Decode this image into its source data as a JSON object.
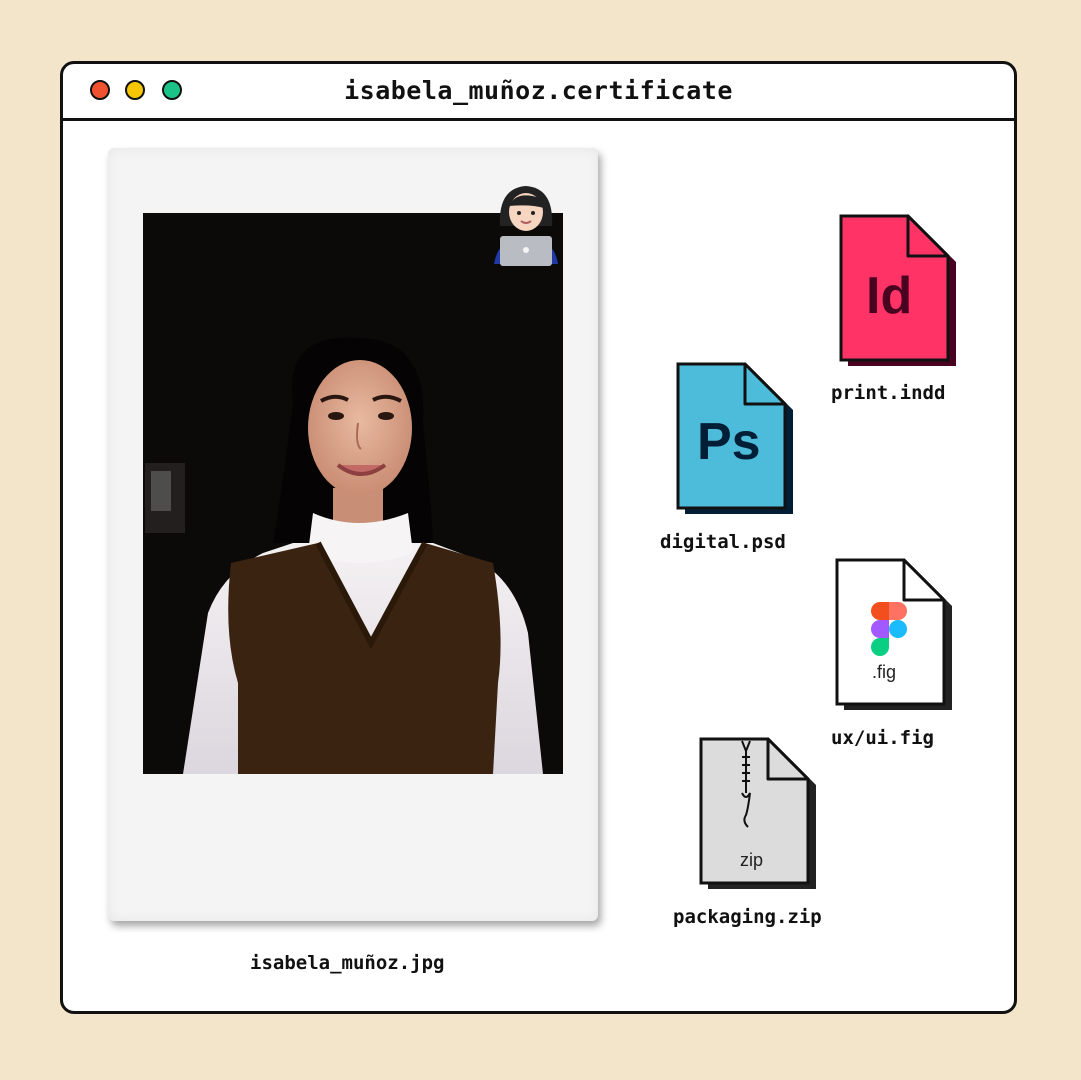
{
  "window": {
    "title": "isabela_muñoz.certificate",
    "controls": [
      {
        "name": "close",
        "color": "#f0522f"
      },
      {
        "name": "minimize",
        "color": "#f6c700"
      },
      {
        "name": "maximize",
        "color": "#1cc389"
      }
    ]
  },
  "photo": {
    "caption": "isabela_muñoz.jpg",
    "sticker": "woman-technologist-emoji"
  },
  "files": [
    {
      "name": "print.indd",
      "icon_text": "Id",
      "color": "#ff3366",
      "text_color": "#49021f"
    },
    {
      "name": "digital.psd",
      "icon_text": "Ps",
      "color": "#4dbcda",
      "text_color": "#001e36"
    },
    {
      "name": "ux/ui.fig",
      "icon_text": ".fig",
      "color": "#ffffff",
      "text_color": "#222222"
    },
    {
      "name": "packaging.zip",
      "icon_text": "zip",
      "color": "#dcdcdc",
      "text_color": "#222222"
    }
  ]
}
